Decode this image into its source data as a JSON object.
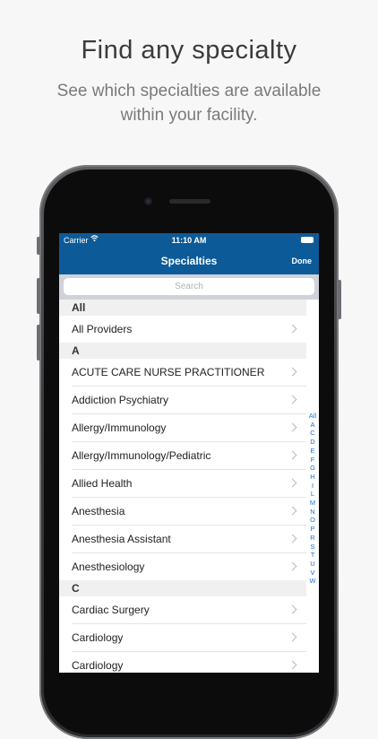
{
  "promo": {
    "headline": "Find any specialty",
    "subline": "See which specialties are available within your facility."
  },
  "status_bar": {
    "carrier": "Carrier",
    "wifi_icon": "wifi-icon",
    "time": "11:10 AM"
  },
  "nav": {
    "title": "Specialties",
    "done_label": "Done"
  },
  "search": {
    "placeholder": "Search"
  },
  "sections": [
    {
      "header": "All",
      "items": [
        "All Providers"
      ]
    },
    {
      "header": "A",
      "items": [
        "ACUTE CARE NURSE PRACTITIONER",
        "Addiction Psychiatry",
        "Allergy/Immunology",
        "Allergy/Immunology/Pediatric",
        "Allied Health",
        "Anesthesia",
        "Anesthesia Assistant",
        "Anesthesiology"
      ]
    },
    {
      "header": "C",
      "items": [
        "Cardiac Surgery",
        "Cardiology",
        "Cardiology"
      ]
    }
  ],
  "index_letters": [
    "All",
    "A",
    "C",
    "D",
    "E",
    "F",
    "G",
    "H",
    "I",
    "L",
    "M",
    "N",
    "O",
    "P",
    "R",
    "S",
    "T",
    "U",
    "V",
    "W"
  ],
  "colors": {
    "nav_bar": "#0d5a98",
    "index_link": "#1a73d1"
  }
}
